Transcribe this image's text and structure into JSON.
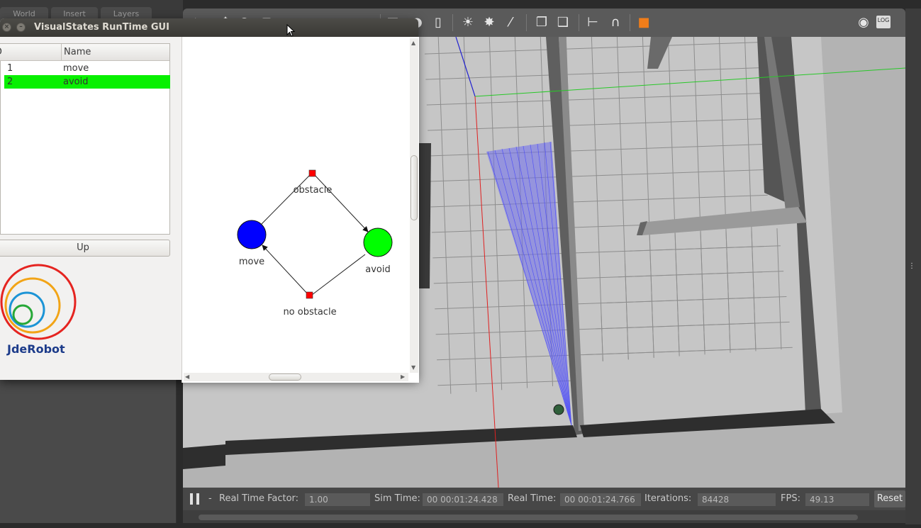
{
  "gazebo": {
    "tabs": [
      "World",
      "Insert",
      "Layers"
    ],
    "toolbar_icons": [
      "select-icon",
      "translate-icon",
      "rotate-icon",
      "scale-icon",
      "undo-icon",
      "redo-icon",
      "box-icon",
      "sphere-icon",
      "cylinder-icon",
      "point-light-icon",
      "spot-light-icon",
      "directional-light-icon",
      "copy-icon",
      "paste-icon",
      "align-icon",
      "snap-icon",
      "view-angle-icon",
      "screenshot-icon",
      "log-icon"
    ],
    "screenshot_label": "LOG",
    "status": {
      "real_time_factor_label": "Real Time Factor:",
      "real_time_factor": "1.00",
      "sim_time_label": "Sim Time:",
      "sim_time": "00 00:01:24.428",
      "real_time_label": "Real Time:",
      "real_time": "00 00:01:24.766",
      "iterations_label": "Iterations:",
      "iterations": "84428",
      "fps_label": "FPS:",
      "fps": "49.13",
      "reset_label": "Reset",
      "step_label": "-"
    }
  },
  "visualstates": {
    "title": "VisualStates RunTime GUI",
    "table": {
      "headers": [
        "ID",
        "Name"
      ],
      "rows": [
        {
          "id": "1",
          "name": "move",
          "selected": false
        },
        {
          "id": "2",
          "name": "avoid",
          "selected": true
        }
      ]
    },
    "up_label": "Up",
    "logo_text": "JdeRobot",
    "diagram": {
      "states": [
        {
          "name": "move",
          "color": "#0000ff"
        },
        {
          "name": "avoid",
          "color": "#00ff00"
        }
      ],
      "transitions": [
        {
          "name": "obstacle",
          "from": "move",
          "to": "avoid"
        },
        {
          "name": "no obstacle",
          "from": "avoid",
          "to": "move"
        }
      ]
    }
  }
}
